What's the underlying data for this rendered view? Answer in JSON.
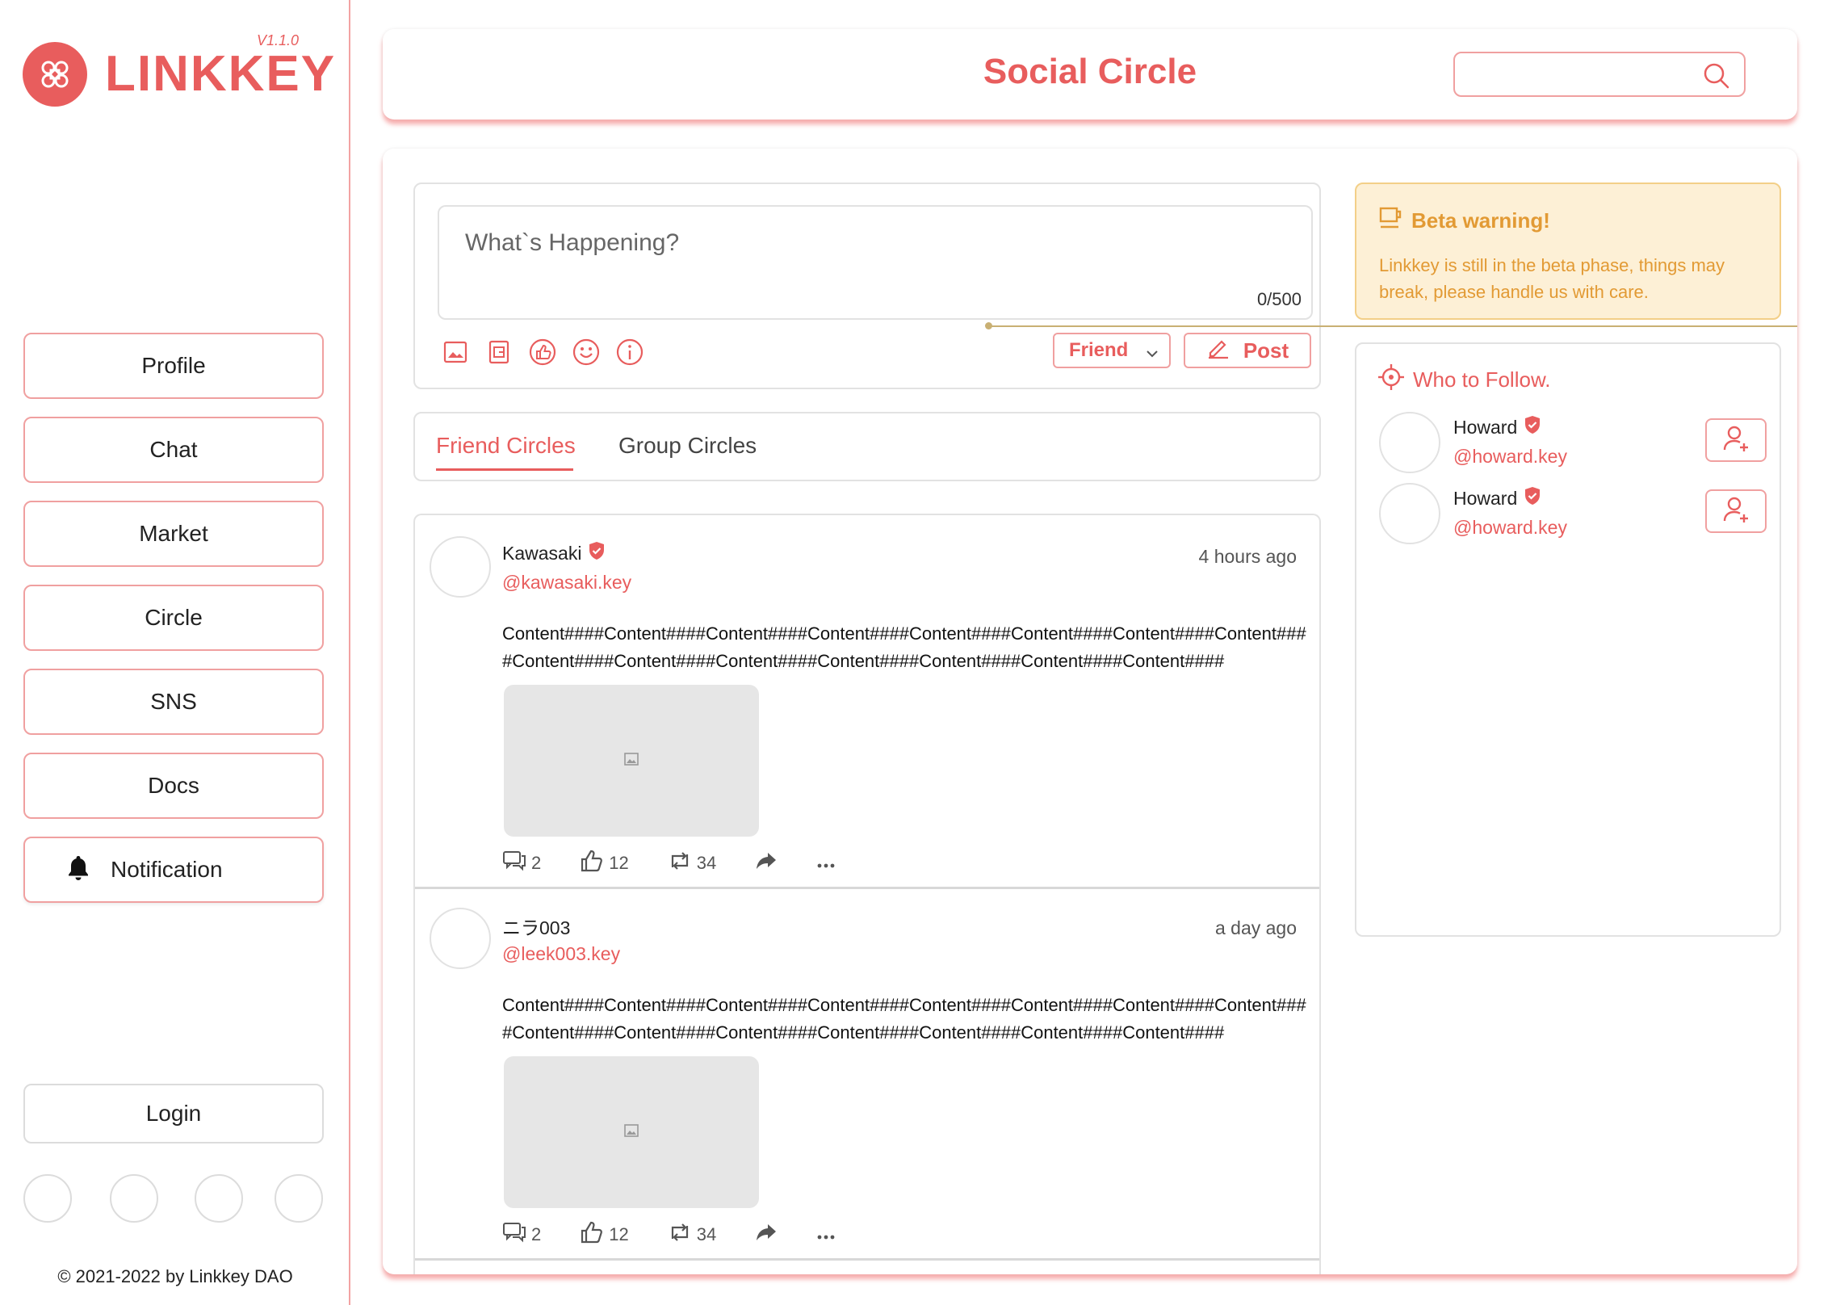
{
  "brand": {
    "name": "LINKKEY",
    "version": "V1.1.0"
  },
  "sidebar": {
    "items": [
      {
        "label": "Profile"
      },
      {
        "label": "Chat"
      },
      {
        "label": "Market"
      },
      {
        "label": "Circle"
      },
      {
        "label": "SNS"
      },
      {
        "label": "Docs"
      }
    ],
    "notification_label": "Notification",
    "login_label": "Login",
    "copyright": "© 2021-2022 by Linkkey DAO"
  },
  "header": {
    "title": "Social Circle",
    "search_value": "",
    "search_icon": "search-icon"
  },
  "composer": {
    "placeholder": "What`s Happening?",
    "counter": "0/500",
    "tools": [
      "image-icon",
      "gif-icon",
      "like-icon",
      "emoji-icon",
      "info-icon"
    ],
    "audience": "Friend",
    "post_label": "Post"
  },
  "tabs": [
    {
      "label": "Friend Circles",
      "active": true
    },
    {
      "label": "Group Circles",
      "active": false
    }
  ],
  "posts": [
    {
      "name": "Kawasaki",
      "verified": true,
      "handle": "@kawasaki.key",
      "time": "4 hours ago",
      "content": "Content####Content####Content####Content####Content####Content####Content####Content####Content####Content####Content####Content####Content####Content####Content####",
      "comments": "2",
      "likes": "12",
      "reposts": "34"
    },
    {
      "name": "ニラ003",
      "verified": false,
      "handle": "@leek003.key",
      "time": "a day ago",
      "content": "Content####Content####Content####Content####Content####Content####Content####Content####Content####Content####Content####Content####Content####Content####Content####",
      "comments": "2",
      "likes": "12",
      "reposts": "34"
    }
  ],
  "beta": {
    "title": "Beta warning!",
    "text": "Linkkey is still in the beta phase, things may break, please handle us with care."
  },
  "follow": {
    "title": "Who to Follow.",
    "users": [
      {
        "name": "Howard",
        "handle": "@howard.key"
      },
      {
        "name": "Howard",
        "handle": "@howard.key"
      }
    ]
  },
  "colors": {
    "accent": "#e85d5d",
    "accent_light": "#f0a0a0",
    "warning_bg": "#fdf0d6",
    "warning_text": "#e29a34"
  }
}
